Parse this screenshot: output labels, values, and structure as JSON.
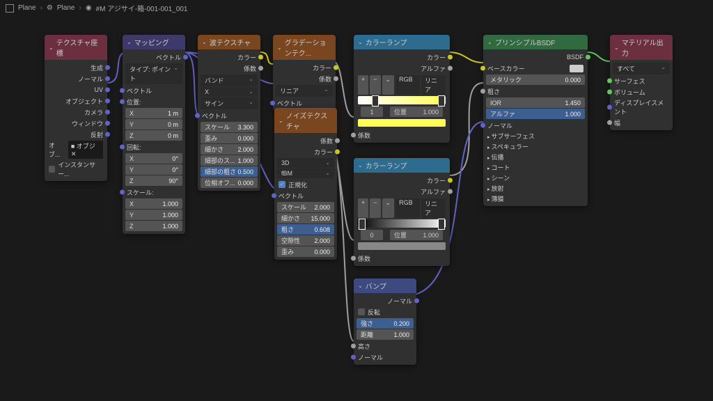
{
  "breadcrumb": [
    {
      "icon": "mesh",
      "label": "Plane"
    },
    {
      "icon": "mod",
      "label": "Plane"
    },
    {
      "icon": "mat",
      "label": "#M アジサイ-箱-001-001_001"
    }
  ],
  "texcoord": {
    "title": "テクスチャ座標",
    "outs": [
      "生成",
      "ノーマル",
      "UV",
      "オブジェクト",
      "カメラ",
      "ウィンドウ",
      "反射"
    ],
    "obj": "オブ...",
    "inst": "インスタンサー..."
  },
  "mapping": {
    "title": "マッピング",
    "out": "ベクトル",
    "type": "タイプ: ポイント",
    "in_vec": "ベクトル",
    "loc": "位置:",
    "rot": "回転:",
    "scale": "スケール:",
    "x": "X",
    "y": "Y",
    "z": "Z",
    "loc_x": "1 m",
    "loc_y": "0 m",
    "loc_z": "0 m",
    "rot_x": "0°",
    "rot_y": "0°",
    "rot_z": "90°",
    "scale_x": "1.000",
    "scale_y": "1.000",
    "scale_z": "1.000"
  },
  "wave": {
    "title": "波テクスチャ",
    "out_col": "カラー",
    "out_fac": "係数",
    "band": "バンド",
    "axis": "X",
    "profile": "サイン",
    "in_vec": "ベクトル",
    "scale": "スケール",
    "scale_v": "3.300",
    "distort": "歪み",
    "distort_v": "0.000",
    "detail": "細かさ",
    "detail_v": "2.000",
    "detail_s": "細部のス...",
    "detail_sv": "1.000",
    "detail_r": "細部の粗さ",
    "detail_rv": "0.500",
    "phase": "位相オフ...",
    "phase_v": "0.000"
  },
  "gradient": {
    "title": "グラデーションテク...",
    "out_col": "カラー",
    "out_fac": "係数",
    "type": "リニア",
    "in_vec": "ベクトル"
  },
  "noise": {
    "title": "ノイズテクスチャ",
    "out_fac": "係数",
    "out_col": "カラー",
    "dim": "3D",
    "type": "fBM",
    "normalize": "正規化",
    "in_vec": "ベクトル",
    "scale": "スケール",
    "scale_v": "2.000",
    "detail": "細かさ",
    "detail_v": "15.000",
    "rough": "粗さ",
    "rough_v": "0.608",
    "lacun": "空隙性",
    "lacun_v": "2.000",
    "distort": "歪み",
    "distort_v": "0.000"
  },
  "ramp1": {
    "title": "カラーランプ",
    "out_col": "カラー",
    "out_alpha": "アルファ",
    "mode": "RGB",
    "interp": "リニア",
    "pos_lbl": "位置",
    "pos_v": "1.000",
    "idx": "1",
    "in_fac": "係数"
  },
  "ramp2": {
    "title": "カラーランプ",
    "out_col": "カラー",
    "out_alpha": "アルファ",
    "mode": "RGB",
    "interp": "リニア",
    "pos_lbl": "位置",
    "pos_v": "1.000",
    "idx": "0",
    "in_fac": "係数"
  },
  "bump": {
    "title": "バンプ",
    "out_norm": "ノーマル",
    "invert": "反転",
    "strength": "強さ",
    "strength_v": "0.200",
    "dist": "距離",
    "dist_v": "1.000",
    "height": "高さ",
    "normal": "ノーマル"
  },
  "bsdf": {
    "title": "プリンシプルBSDF",
    "out": "BSDF",
    "base": "ベースカラー",
    "metal": "メタリック",
    "metal_v": "0.000",
    "rough": "粗さ",
    "ior": "IOR",
    "ior_v": "1.450",
    "alpha": "アルファ",
    "alpha_v": "1.000",
    "normal": "ノーマル",
    "groups": [
      "サブサーフェス",
      "スペキュラー",
      "伝播",
      "コート",
      "シーン",
      "放射",
      "薄膜"
    ]
  },
  "output": {
    "title": "マテリアル出力",
    "target": "すべて",
    "surface": "サーフェス",
    "volume": "ボリューム",
    "disp": "ディスプレイスメント",
    "thick": "幅"
  }
}
